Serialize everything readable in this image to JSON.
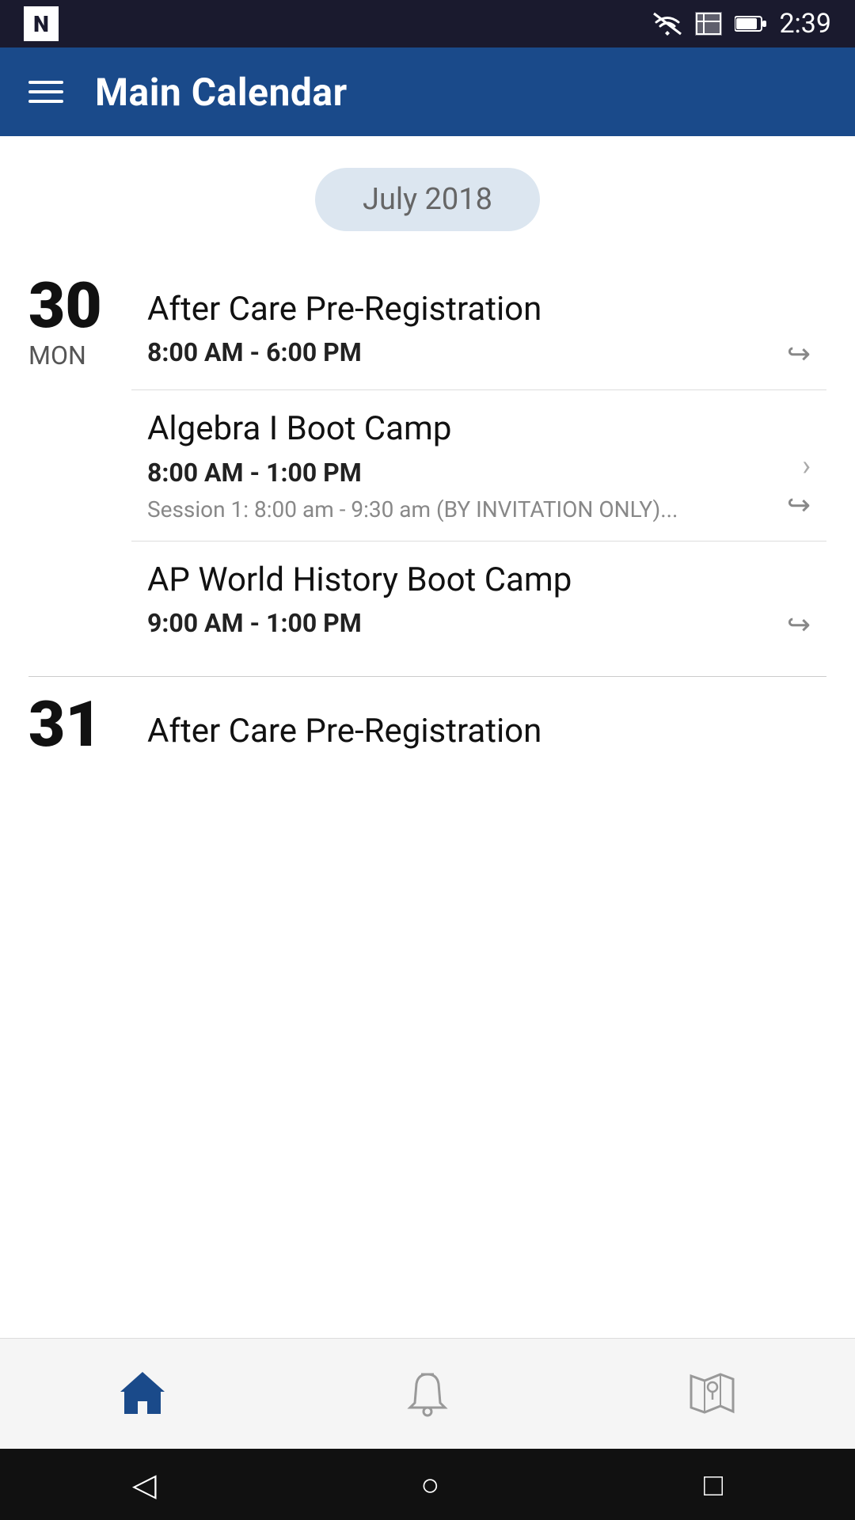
{
  "statusBar": {
    "time": "2:39",
    "logo": "N"
  },
  "appBar": {
    "title": "Main Calendar",
    "menuLabel": "Menu"
  },
  "monthPill": {
    "label": "July 2018"
  },
  "days": [
    {
      "day": "30",
      "weekday": "MON",
      "events": [
        {
          "id": "event1",
          "title": "After Care Pre-Registration",
          "time": "8:00 AM - 6:00 PM",
          "desc": "",
          "hasChevron": false,
          "hasShare": true
        },
        {
          "id": "event2",
          "title": "Algebra I Boot Camp",
          "time": "8:00 AM - 1:00 PM",
          "desc": "Session 1: 8:00 am - 9:30 am (BY INVITATION ONLY)...",
          "hasChevron": true,
          "hasShare": true
        },
        {
          "id": "event3",
          "title": "AP World History Boot Camp",
          "time": "9:00 AM - 1:00 PM",
          "desc": "",
          "hasChevron": false,
          "hasShare": true
        }
      ]
    }
  ],
  "partialDay": {
    "day": "31",
    "title": "After Care Pre-Registration"
  },
  "bottomNav": {
    "items": [
      {
        "id": "home",
        "label": "Home",
        "icon": "home",
        "active": true
      },
      {
        "id": "notifications",
        "label": "Notifications",
        "icon": "bell",
        "active": false
      },
      {
        "id": "map",
        "label": "Map",
        "icon": "map",
        "active": false
      }
    ]
  },
  "androidNav": {
    "back": "◁",
    "home": "○",
    "recent": "□"
  }
}
